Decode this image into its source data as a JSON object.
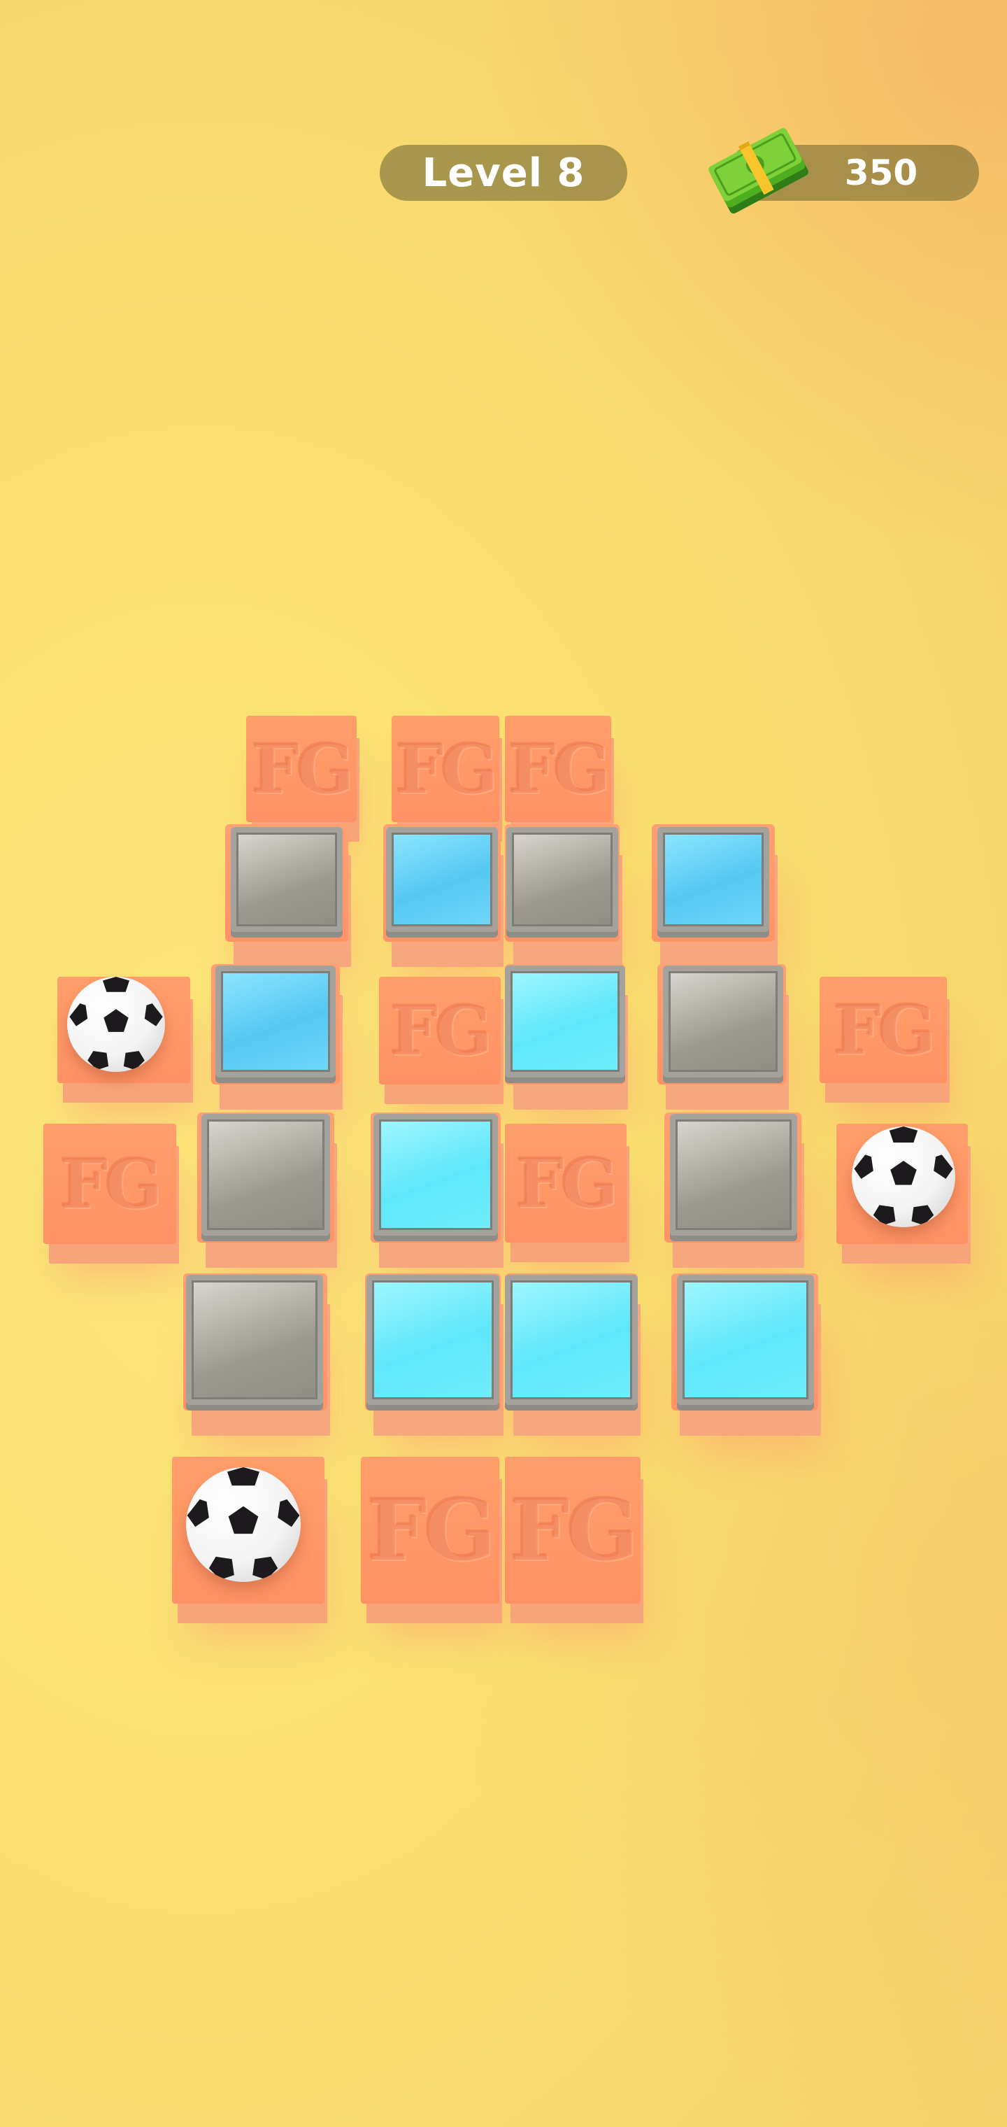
{
  "hud": {
    "level_label": "Level 8",
    "cash_amount": "350",
    "cash_icon": "money-stack-icon"
  },
  "board": {
    "brick_logo": "FG",
    "colors": {
      "brick": "#ff9a68",
      "blue_tile": "#5ccaf2",
      "cyan_tile": "#63e9fb",
      "gray_tile": "#a09e95",
      "tile_frame": "#a4a29c"
    },
    "legend": {
      "B": "orange FG block",
      "K": "orange block with soccer ball",
      "G": "gray pressure tile",
      "L": "blue pressure tile",
      "C": "cyan pressure tile"
    },
    "rows": [
      [
        "B",
        "B",
        "B"
      ],
      [
        "G",
        "L",
        "G",
        "L"
      ],
      [
        "K",
        "L",
        "B",
        "C",
        "G",
        "B"
      ],
      [
        "B",
        "G",
        "C",
        "B",
        "G",
        "K"
      ],
      [
        "G",
        "C",
        "C",
        "C"
      ],
      [
        "K",
        "B",
        "B"
      ]
    ]
  }
}
